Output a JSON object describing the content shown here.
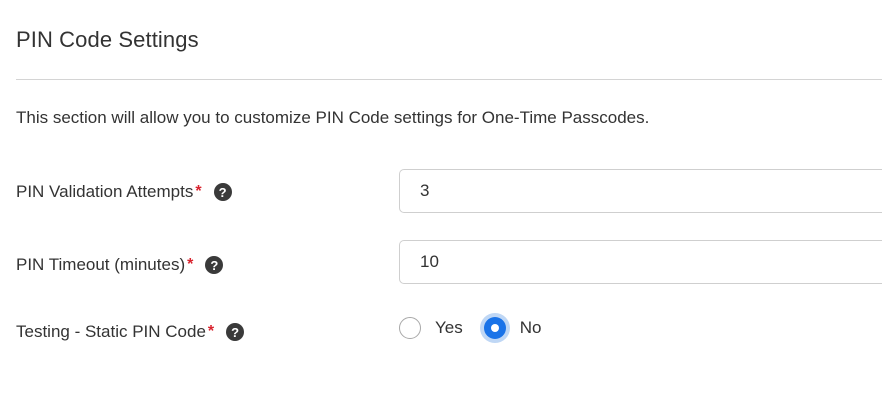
{
  "section": {
    "title": "PIN Code Settings",
    "description": "This section will allow you to customize PIN Code settings for One-Time Passcodes."
  },
  "fields": [
    {
      "label": "PIN Validation Attempts",
      "required_mark": "*",
      "help_icon": "question-circle-icon",
      "value": "3"
    },
    {
      "label": "PIN Timeout (minutes)",
      "required_mark": "*",
      "help_icon": "question-circle-icon",
      "value": "10"
    },
    {
      "label": "Testing - Static PIN Code",
      "required_mark": "*",
      "help_icon": "question-circle-icon",
      "options": [
        "Yes",
        "No"
      ],
      "selected": "No"
    }
  ],
  "help_glyph": "?",
  "colors": {
    "required": "#d9232e",
    "radio_selected": "#1a73e8",
    "radio_focus_ring": "#bfd7f5",
    "divider": "#d4d4d4"
  }
}
